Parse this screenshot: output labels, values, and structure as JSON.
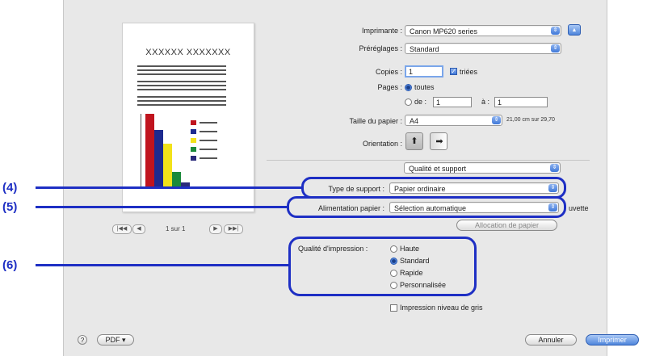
{
  "printer": {
    "label": "Imprimante :",
    "value": "Canon MP620 series"
  },
  "presets": {
    "label": "Préréglages :",
    "value": "Standard"
  },
  "copies": {
    "label": "Copies :",
    "value": "1",
    "collated_label": "triées",
    "collated": true
  },
  "pages": {
    "label": "Pages :",
    "all_label": "toutes",
    "range_label": "de :",
    "from": "1",
    "to_label": "à :",
    "to": "1"
  },
  "paper_size": {
    "label": "Taille du papier :",
    "value": "A4",
    "dims": "21,00 cm sur 29,70"
  },
  "orientation": {
    "label": "Orientation :",
    "portrait_glyph": "⬆",
    "landscape_glyph": "⬆"
  },
  "panel_select": {
    "value": "Qualité et support"
  },
  "media_type": {
    "label": "Type de support :",
    "value": "Papier ordinaire"
  },
  "paper_source": {
    "label": "Alimentation papier :",
    "value": "Sélection automatique",
    "trailing": "uvette"
  },
  "paper_allocation_button": "Allocation de papier",
  "print_quality": {
    "label": "Qualité d'impression :",
    "options": [
      "Haute",
      "Standard",
      "Rapide",
      "Personnalisée"
    ],
    "selected": "Standard"
  },
  "grayscale": {
    "label": "Impression niveau de gris",
    "checked": false
  },
  "preview": {
    "title": "XXXXXX XXXXXXX",
    "page_indicator": "1 sur 1",
    "nav_first": "|◀◀",
    "nav_prev": "◀",
    "nav_next": "▶",
    "nav_last": "▶▶|",
    "bar_colors": [
      "#c0141e",
      "#1d2a8f",
      "#f2e21a",
      "#1b8a3a",
      "#2a2a7a"
    ],
    "bar_values": [
      100,
      78,
      60,
      22,
      8
    ]
  },
  "help_glyph": "?",
  "pdf_button": "PDF ▾",
  "cancel_button": "Annuler",
  "print_button": "Imprimer",
  "collapse_glyph": "▲",
  "callouts": [
    "(4)",
    "(5)",
    "(6)"
  ],
  "colors": {
    "callout": "#1e2fc4",
    "accent": "#3f78d8"
  }
}
